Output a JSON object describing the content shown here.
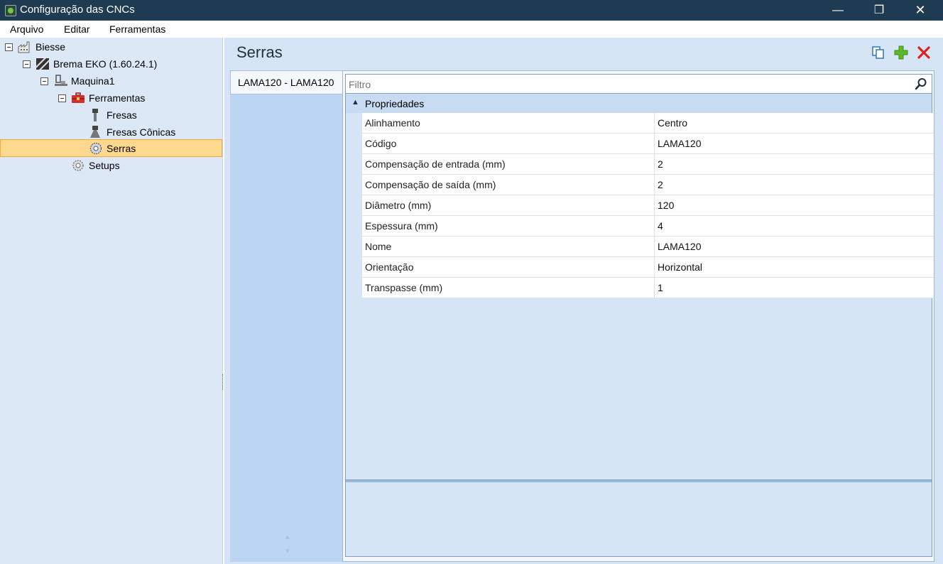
{
  "window": {
    "title": "Configuração das CNCs",
    "min": "—",
    "max": "❐",
    "close": "✕"
  },
  "menu": {
    "items": [
      "Arquivo",
      "Editar",
      "Ferramentas"
    ]
  },
  "tree": {
    "nodes": [
      {
        "label": "Biesse",
        "icon": "factory-icon"
      },
      {
        "label": "Brema EKO (1.60.24.1)",
        "icon": "machine-brand-icon"
      },
      {
        "label": "Maquina1",
        "icon": "machine-icon"
      },
      {
        "label": "Ferramentas",
        "icon": "toolbox-icon"
      },
      {
        "label": "Fresas",
        "icon": "mill-icon"
      },
      {
        "label": "Fresas Cônicas",
        "icon": "conical-mill-icon"
      },
      {
        "label": "Serras",
        "icon": "saw-icon",
        "selected": true
      },
      {
        "label": "Setups",
        "icon": "setup-gear-icon"
      }
    ]
  },
  "page": {
    "title": "Serras",
    "tabs": [
      {
        "label": "LAMA120 - LAMA120",
        "active": true
      }
    ],
    "filter_placeholder": "Filtro",
    "category": "Propriedades",
    "properties": [
      {
        "name": "Alinhamento",
        "value": "Centro"
      },
      {
        "name": "Código",
        "value": "LAMA120"
      },
      {
        "name": "Compensação de entrada (mm)",
        "value": "2"
      },
      {
        "name": "Compensação de saída (mm)",
        "value": "2"
      },
      {
        "name": "Diâmetro (mm)",
        "value": "120"
      },
      {
        "name": "Espessura (mm)",
        "value": "4"
      },
      {
        "name": "Nome",
        "value": "LAMA120"
      },
      {
        "name": "Orientação",
        "value": "Horizontal"
      },
      {
        "name": "Transpasse (mm)",
        "value": "1"
      }
    ]
  },
  "colors": {
    "titlebar": "#1e3b52",
    "tree_bg": "#dce8f6",
    "selected_bg": "#fdd88e",
    "panel_bg": "#d6e5f5",
    "add_icon": "#5db92a",
    "delete_icon": "#e02020"
  }
}
